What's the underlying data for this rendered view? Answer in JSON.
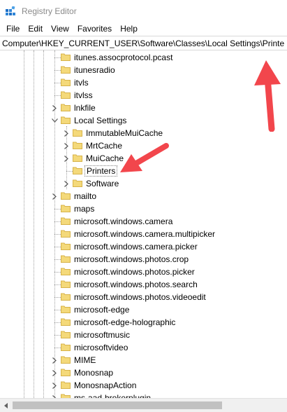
{
  "window": {
    "title": "Registry Editor"
  },
  "menu": [
    "File",
    "Edit",
    "View",
    "Favorites",
    "Help"
  ],
  "address": {
    "value": "Computer\\HKEY_CURRENT_USER\\Software\\Classes\\Local Settings\\Printers"
  },
  "colors": {
    "folder": "#f4d97a",
    "folder_edge": "#d7b34a",
    "annotation_arrow": "#f2464c"
  },
  "tree": [
    {
      "label": "itunes.assocprotocol.pcast",
      "depth": 0,
      "expander": "none"
    },
    {
      "label": "itunesradio",
      "depth": 0,
      "expander": "none"
    },
    {
      "label": "itvls",
      "depth": 0,
      "expander": "none"
    },
    {
      "label": "itvlss",
      "depth": 0,
      "expander": "none"
    },
    {
      "label": "lnkfile",
      "depth": 0,
      "expander": "collapsed"
    },
    {
      "label": "Local Settings",
      "depth": 0,
      "expander": "expanded"
    },
    {
      "label": "ImmutableMuiCache",
      "depth": 1,
      "expander": "collapsed"
    },
    {
      "label": "MrtCache",
      "depth": 1,
      "expander": "collapsed"
    },
    {
      "label": "MuiCache",
      "depth": 1,
      "expander": "collapsed"
    },
    {
      "label": "Printers",
      "depth": 1,
      "expander": "none",
      "selected": true
    },
    {
      "label": "Software",
      "depth": 1,
      "expander": "collapsed"
    },
    {
      "label": "mailto",
      "depth": 0,
      "expander": "collapsed"
    },
    {
      "label": "maps",
      "depth": 0,
      "expander": "none"
    },
    {
      "label": "microsoft.windows.camera",
      "depth": 0,
      "expander": "none"
    },
    {
      "label": "microsoft.windows.camera.multipicker",
      "depth": 0,
      "expander": "none"
    },
    {
      "label": "microsoft.windows.camera.picker",
      "depth": 0,
      "expander": "none"
    },
    {
      "label": "microsoft.windows.photos.crop",
      "depth": 0,
      "expander": "none"
    },
    {
      "label": "microsoft.windows.photos.picker",
      "depth": 0,
      "expander": "none"
    },
    {
      "label": "microsoft.windows.photos.search",
      "depth": 0,
      "expander": "none"
    },
    {
      "label": "microsoft.windows.photos.videoedit",
      "depth": 0,
      "expander": "none"
    },
    {
      "label": "microsoft-edge",
      "depth": 0,
      "expander": "none"
    },
    {
      "label": "microsoft-edge-holographic",
      "depth": 0,
      "expander": "none"
    },
    {
      "label": "microsoftmusic",
      "depth": 0,
      "expander": "none"
    },
    {
      "label": "microsoftvideo",
      "depth": 0,
      "expander": "none"
    },
    {
      "label": "MIME",
      "depth": 0,
      "expander": "collapsed"
    },
    {
      "label": "Monosnap",
      "depth": 0,
      "expander": "collapsed"
    },
    {
      "label": "MonosnapAction",
      "depth": 0,
      "expander": "collapsed"
    },
    {
      "label": "ms-aad-brokerplugin",
      "depth": 0,
      "expander": "collapsed"
    }
  ]
}
